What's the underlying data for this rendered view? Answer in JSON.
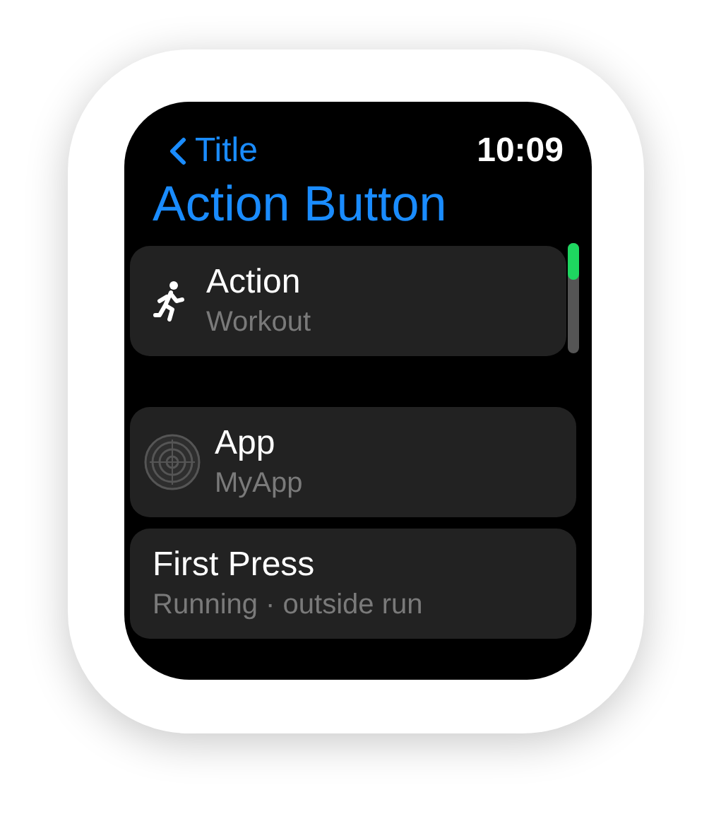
{
  "nav": {
    "back_label": "Title",
    "time": "10:09"
  },
  "title": "Action Button",
  "sections": [
    [
      {
        "kind": "workout",
        "title": "Action",
        "subtitle": "Workout"
      }
    ],
    [
      {
        "kind": "app",
        "title": "App",
        "subtitle": "MyApp"
      },
      {
        "kind": "plain",
        "title": "First Press",
        "subtitle": "Running · outside run"
      }
    ]
  ]
}
